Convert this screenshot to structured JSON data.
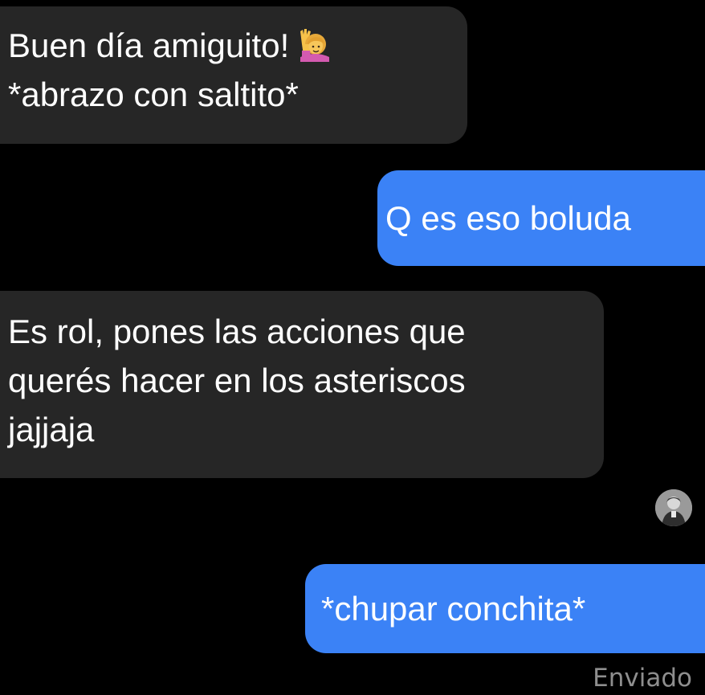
{
  "messages": [
    {
      "direction": "received",
      "lines": [
        "Buen día amiguito!",
        "*abrazo con saltito*"
      ],
      "emoji": "person-raising-hand-emoji"
    },
    {
      "direction": "sent",
      "lines": [
        "Q es eso boluda"
      ]
    },
    {
      "direction": "received",
      "lines": [
        "Es rol, pones las acciones que",
        "querés hacer en los asteriscos",
        "jajjaja"
      ]
    },
    {
      "direction": "sent",
      "lines": [
        "*chupar conchita*"
      ]
    }
  ],
  "status": "Enviado",
  "colors": {
    "background": "#000000",
    "received_bubble": "#262626",
    "sent_bubble": "#3b82f6",
    "text": "#ffffff",
    "status_text": "#8e8e8e"
  },
  "icons": {
    "avatar": "profile-avatar"
  }
}
